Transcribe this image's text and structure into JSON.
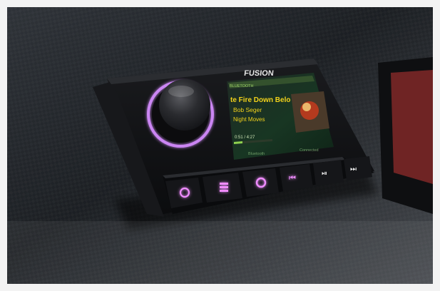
{
  "photo": {
    "brand": "FUSION",
    "screen": {
      "source": "BLUETOOTH",
      "track_title": "te Fire Down Belo",
      "artist": "Bob Seger",
      "album": "Night Moves",
      "time": "0:51 / 4:27",
      "footer_left": "Bluetooth",
      "footer_right": "Connected"
    },
    "buttons": [
      "power-icon",
      "menu-icon",
      "source-icon",
      "previous-icon",
      "play-pause-icon",
      "next-icon"
    ],
    "colors": {
      "knob_glow": "#d58cff",
      "button_glow": "#f08cff",
      "screen_accent": "#8fd14f",
      "title_yellow": "#f2d21b"
    }
  }
}
